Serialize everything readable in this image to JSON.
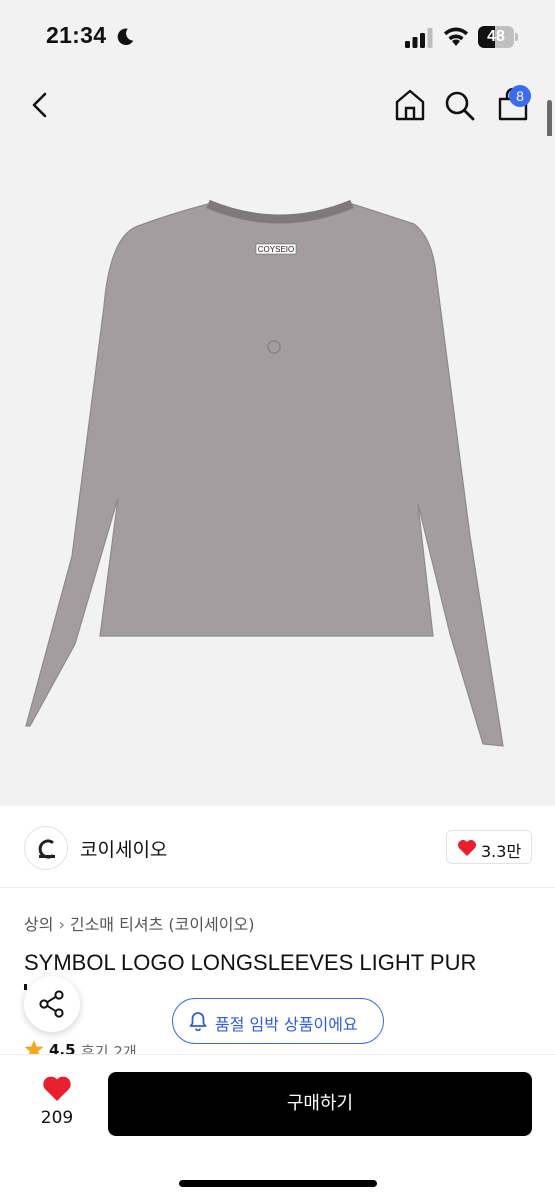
{
  "status_bar": {
    "time": "21:34",
    "battery_level": "48",
    "icons": [
      "moon-icon",
      "signal-icon",
      "wifi-icon",
      "battery-icon"
    ]
  },
  "header": {
    "icons": [
      "back-icon",
      "home-icon",
      "search-icon",
      "shopping-bag-icon"
    ],
    "cart_count": "8"
  },
  "product_image": {
    "garment_color": "#a39d9f",
    "neck_label": "COYSEIO"
  },
  "brand": {
    "name": "코이세이오",
    "like_count": "3.3만"
  },
  "breadcrumb": [
    "상의",
    "긴소매 티셔츠 (코이세이오)"
  ],
  "product": {
    "title": "SYMBOL LOGO LONGSLEEVES LIGHT PUR",
    "rating": "4.5",
    "reviews": "후기 2개"
  },
  "floating": {
    "stock_notice": "품절 임박 상품이에요"
  },
  "bottom_bar": {
    "wish_count": "209",
    "buy_label": "구매하기"
  },
  "colors": {
    "accent_blue": "#3b6cf0",
    "heart_red": "#e8202e",
    "buy_button": "#000000"
  }
}
